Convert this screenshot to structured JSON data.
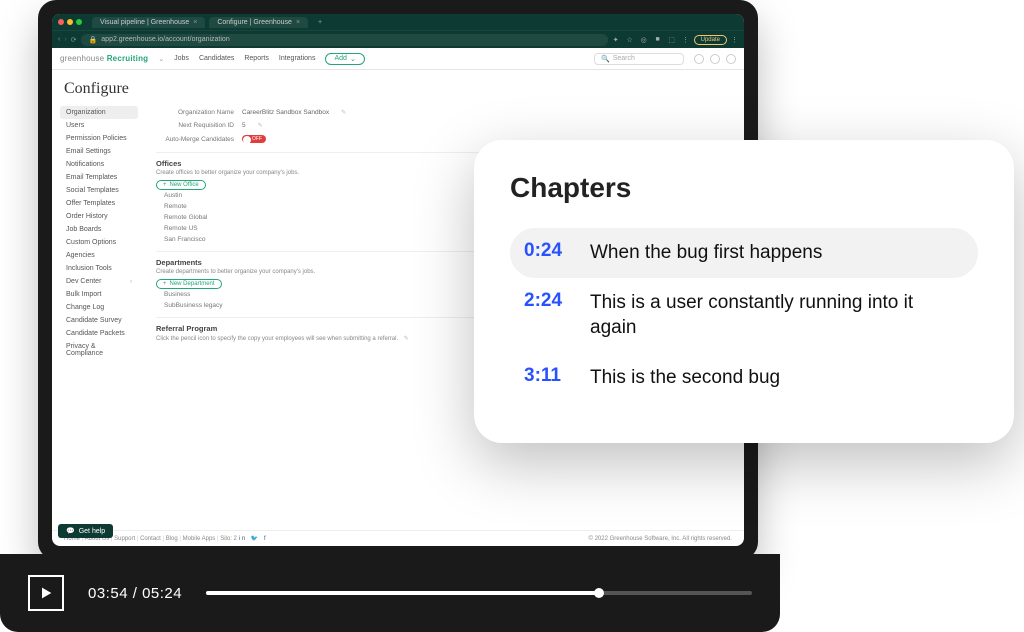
{
  "browser": {
    "tabs": [
      {
        "title": "Visual pipeline | Greenhouse"
      },
      {
        "title": "Configure | Greenhouse"
      }
    ],
    "url": "app2.greenhouse.io/account/organization",
    "update": "Update"
  },
  "app": {
    "logo_prefix": "greenhouse",
    "logo_accent": "Recruiting",
    "nav": [
      "Jobs",
      "Candidates",
      "Reports",
      "Integrations"
    ],
    "add": "Add",
    "search_placeholder": "Search"
  },
  "page": {
    "title": "Configure",
    "sidebar": [
      "Organization",
      "Users",
      "Permission Policies",
      "Email Settings",
      "Notifications",
      "Email Templates",
      "Social Templates",
      "Offer Templates",
      "Order History",
      "Job Boards",
      "Custom Options",
      "Agencies",
      "Inclusion Tools",
      "Dev Center",
      "Bulk Import",
      "Change Log",
      "Candidate Survey",
      "Candidate Packets",
      "Privacy & Compliance"
    ],
    "org": {
      "name_label": "Organization Name",
      "name_value": "CareerBlitz Sandbox Sandbox",
      "req_label": "Next Requisition ID",
      "req_value": "5",
      "merge_label": "Auto-Merge Candidates",
      "merge_state": "OFF"
    },
    "offices": {
      "heading": "Offices",
      "sub": "Create offices to better organize your company's jobs.",
      "button": "New Office",
      "items": [
        "Austin",
        "Remote",
        "Remote Global",
        "Remote US",
        "San Francisco"
      ]
    },
    "departments": {
      "heading": "Departments",
      "sub": "Create departments to better organize your company's jobs.",
      "button": "New Department",
      "items": [
        "Business",
        "SubBusiness legacy"
      ]
    },
    "referral": {
      "heading": "Referral Program",
      "sub": "Click the pencil icon to specify the copy your employees will see when submitting a referral."
    }
  },
  "footer": {
    "links": [
      "Home",
      "About Us",
      "Support",
      "Contact",
      "Blog",
      "Mobile Apps",
      "Silo: 2"
    ],
    "copyright": "© 2022 Greenhouse Software, Inc. All rights reserved."
  },
  "help": "Get help",
  "player": {
    "current": "03:54",
    "total": "05:24",
    "progress_pct": 72
  },
  "chapters": {
    "heading": "Chapters",
    "items": [
      {
        "time": "0:24",
        "title": "When the bug first happens",
        "active": true
      },
      {
        "time": "2:24",
        "title": "This is a user constantly running into it again",
        "active": false
      },
      {
        "time": "3:11",
        "title": "This is the second bug",
        "active": false
      }
    ]
  }
}
